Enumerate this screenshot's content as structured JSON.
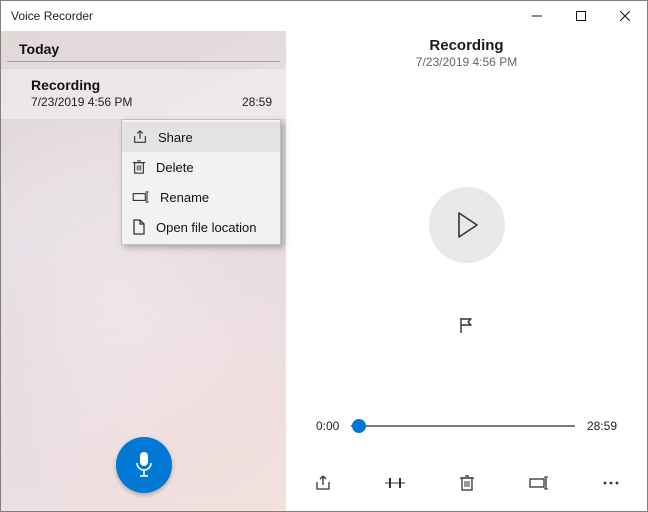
{
  "window": {
    "title": "Voice Recorder"
  },
  "sidebar": {
    "section": "Today",
    "items": [
      {
        "title": "Recording",
        "timestamp": "7/23/2019 4:56 PM",
        "duration": "28:59"
      }
    ]
  },
  "player": {
    "title": "Recording",
    "timestamp": "7/23/2019 4:56 PM",
    "elapsed": "0:00",
    "total": "28:59"
  },
  "context_menu": [
    "Share",
    "Delete",
    "Rename",
    "Open file location"
  ],
  "colors": {
    "accent": "#0078d4"
  }
}
